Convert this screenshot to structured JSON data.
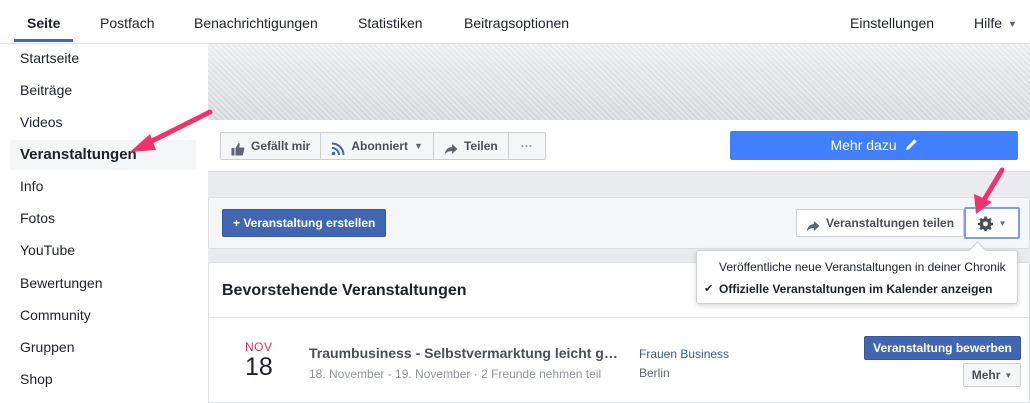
{
  "topnav": {
    "tabs": [
      {
        "label": "Seite",
        "active": true
      },
      {
        "label": "Postfach"
      },
      {
        "label": "Benachrichtigungen"
      },
      {
        "label": "Statistiken"
      },
      {
        "label": "Beitragsoptionen"
      }
    ],
    "settings_label": "Einstellungen",
    "help_label": "Hilfe"
  },
  "sidebar": {
    "items": [
      {
        "label": "Startseite"
      },
      {
        "label": "Beiträge"
      },
      {
        "label": "Videos"
      },
      {
        "label": "Veranstaltungen",
        "active": true
      },
      {
        "label": "Info"
      },
      {
        "label": "Fotos"
      },
      {
        "label": "YouTube"
      },
      {
        "label": "Bewertungen"
      },
      {
        "label": "Community"
      },
      {
        "label": "Gruppen"
      },
      {
        "label": "Shop"
      }
    ]
  },
  "actionbar": {
    "like_label": "Gefällt mir",
    "follow_label": "Abonniert",
    "share_label": "Teilen",
    "more_label": "···",
    "learn_more_label": "Mehr dazu"
  },
  "events_toolbar": {
    "create_label": "+ Veranstaltung erstellen",
    "share_events_label": "Veranstaltungen teilen"
  },
  "settings_menu": {
    "items": [
      {
        "label": "Veröffentliche neue Veranstaltungen in deiner Chronik",
        "checked": false
      },
      {
        "label": "Offizielle Veranstaltungen im Kalender anzeigen",
        "checked": true
      }
    ],
    "check_glyph": "✔"
  },
  "upcoming": {
    "title": "Bevorstehende Veranstaltungen",
    "events": [
      {
        "month": "NOV",
        "day": "18",
        "title": "Traumbusiness - Selbstvermarktung leicht gemacht",
        "subtitle": "18. November - 19. November · 2 Freunde nehmen teil",
        "organizer": "Frauen Business",
        "location": "Berlin",
        "promote_label": "Veranstaltung bewerben",
        "more_label": "Mehr"
      }
    ]
  },
  "colors": {
    "brand_blue": "#4267b2",
    "cta_blue": "#4080ff",
    "arrow_pink": "#f0326e",
    "date_red": "#f02849"
  }
}
